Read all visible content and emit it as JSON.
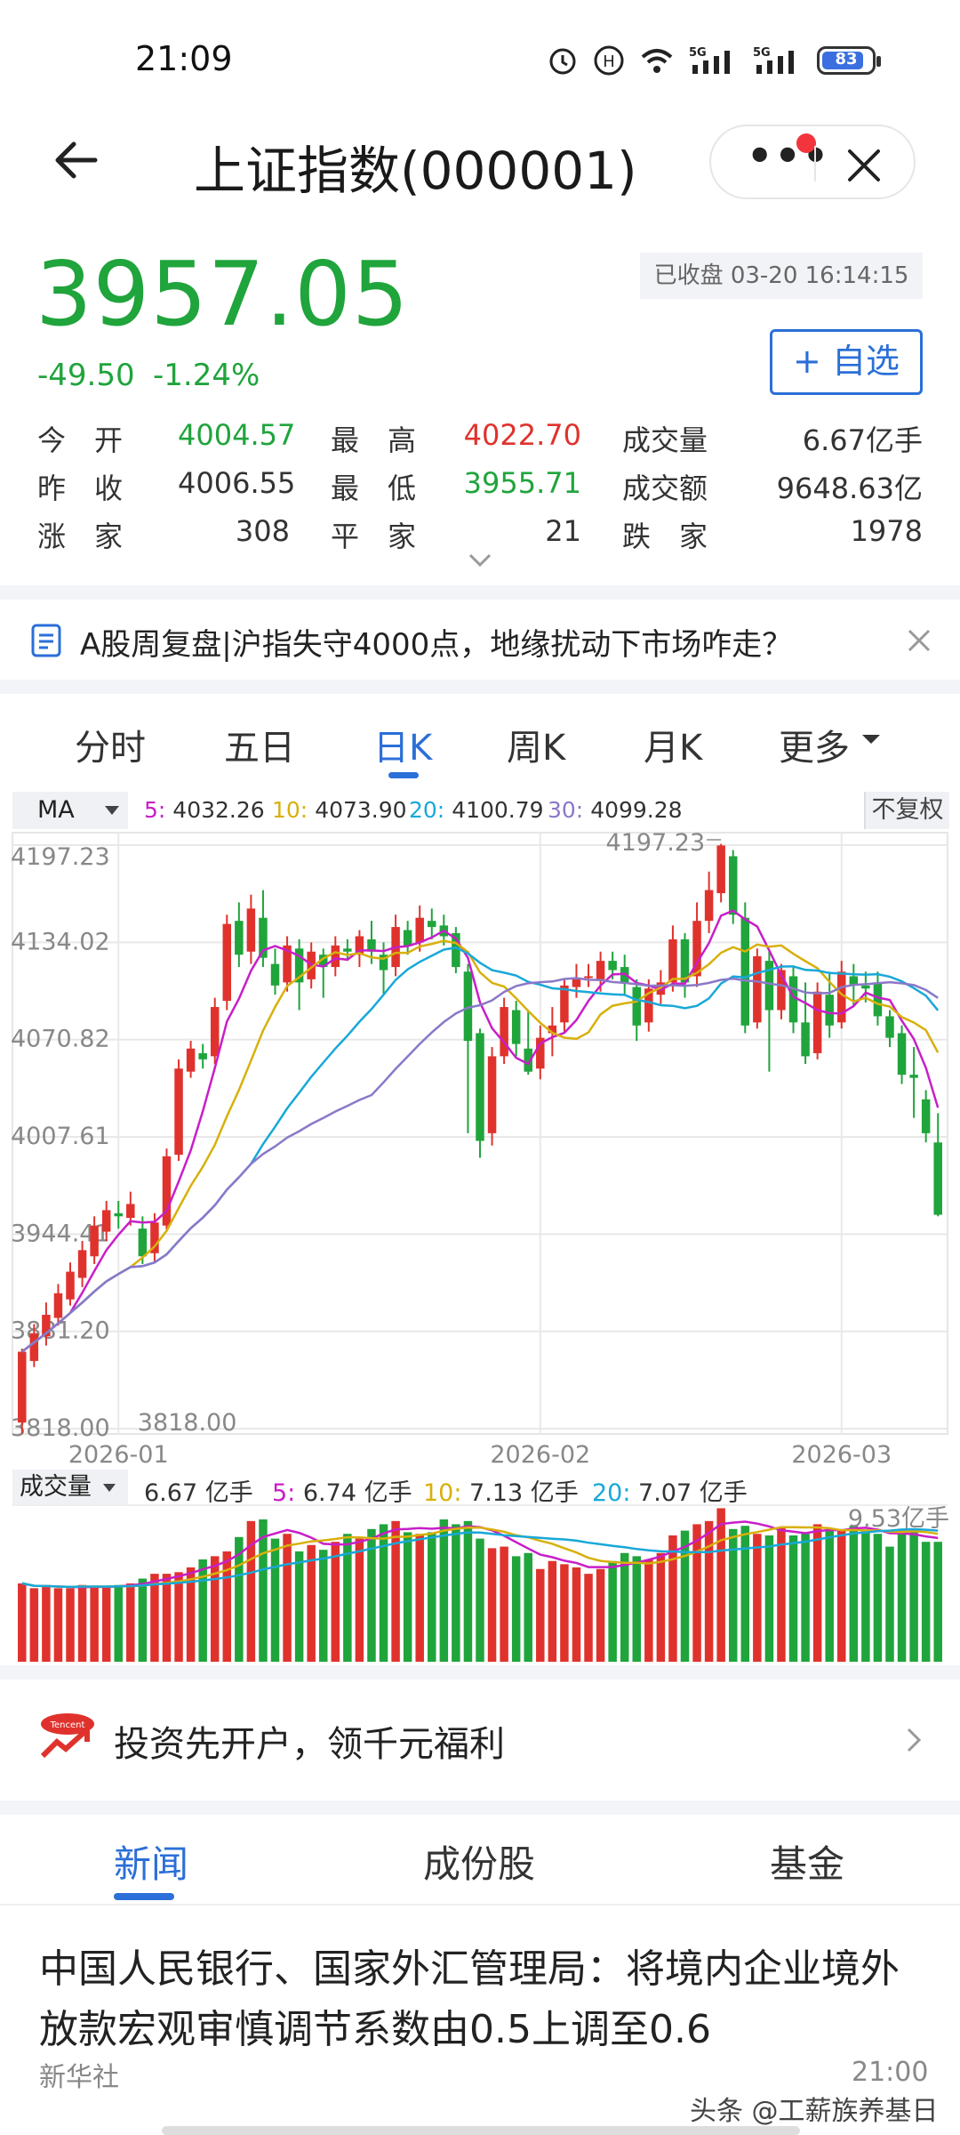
{
  "status_bar": {
    "time": "21:09",
    "battery": "83",
    "signal_1": "5G",
    "signal_2": "5G"
  },
  "header": {
    "title": "上证指数(000001)",
    "more_label": "•••"
  },
  "quote": {
    "price": "3957.05",
    "change": "-49.50",
    "change_pct": "-1.24%",
    "status": "已收盘 03-20 16:14:15",
    "watch_label": "+ 自选",
    "stats": [
      {
        "label": "今　开",
        "value": "4004.57"
      },
      {
        "label": "最　高",
        "value": "4022.70"
      },
      {
        "label": "成交量",
        "value": "6.67亿手"
      },
      {
        "label": "昨　收",
        "value": "4006.55"
      },
      {
        "label": "最　低",
        "value": "3955.71"
      },
      {
        "label": "成交额",
        "value": "9648.63亿"
      },
      {
        "label": "涨　家",
        "value": "308"
      },
      {
        "label": "平　家",
        "value": "21"
      },
      {
        "label": "跌　家",
        "value": "1978"
      }
    ]
  },
  "news_banner": {
    "text": "A股周复盘|沪指失守4000点，地缘扰动下市场咋走？"
  },
  "period_tabs": [
    "分时",
    "五日",
    "日K",
    "周K",
    "月K",
    "更多"
  ],
  "ma_bar": {
    "select": "MA",
    "items": [
      {
        "key": "5:",
        "value": "4032.26",
        "color": "#c81ec8"
      },
      {
        "key": "10:",
        "value": "4073.90",
        "color": "#d8b00c"
      },
      {
        "key": "20:",
        "value": "4100.79",
        "color": "#18a8d8"
      },
      {
        "key": "30:",
        "value": "4099.28",
        "color": "#8a78c8"
      }
    ],
    "adjust": "不复权"
  },
  "volume_bar": {
    "select": "成交量",
    "current": "6.67 亿手",
    "items": [
      {
        "key": "5:",
        "value": "6.74 亿手",
        "color": "#c81ec8"
      },
      {
        "key": "10:",
        "value": "7.13 亿手",
        "color": "#d8b00c"
      },
      {
        "key": "20:",
        "value": "7.07 亿手",
        "color": "#18a8d8"
      }
    ],
    "max_label": "9.53亿手"
  },
  "chart_data": {
    "type": "candlestick",
    "ylim": [
      3818.0,
      4197.23
    ],
    "y_ticks": [
      "4197.23",
      "4134.02",
      "4070.82",
      "4007.61",
      "3944.41",
      "3881.20",
      "3818.00"
    ],
    "x_ticks": [
      "2026-01",
      "2026-02",
      "2026-03"
    ],
    "high_label": "4197.23",
    "low_label": "3818.00",
    "candles": [
      [
        3822,
        3868,
        3815,
        3870
      ],
      [
        3862,
        3880,
        3858,
        3886
      ],
      [
        3878,
        3892,
        3872,
        3900
      ],
      [
        3890,
        3906,
        3885,
        3912
      ],
      [
        3902,
        3920,
        3898,
        3926
      ],
      [
        3916,
        3934,
        3910,
        3940
      ],
      [
        3930,
        3950,
        3925,
        3956
      ],
      [
        3946,
        3960,
        3940,
        3966
      ],
      [
        3958,
        3956,
        3948,
        3966
      ],
      [
        3955,
        3964,
        3950,
        3972
      ],
      [
        3948,
        3930,
        3925,
        3956
      ],
      [
        3932,
        3952,
        3926,
        3958
      ],
      [
        3950,
        3995,
        3946,
        4000
      ],
      [
        3996,
        4052,
        3992,
        4058
      ],
      [
        4050,
        4065,
        4046,
        4070
      ],
      [
        4062,
        4058,
        4052,
        4068
      ],
      [
        4060,
        4092,
        4055,
        4098
      ],
      [
        4096,
        4146,
        4090,
        4152
      ],
      [
        4148,
        4126,
        4118,
        4160
      ],
      [
        4128,
        4156,
        4120,
        4165
      ],
      [
        4150,
        4124,
        4118,
        4168
      ],
      [
        4120,
        4106,
        4100,
        4130
      ],
      [
        4108,
        4132,
        4102,
        4138
      ],
      [
        4130,
        4108,
        4090,
        4136
      ],
      [
        4110,
        4128,
        4104,
        4134
      ],
      [
        4126,
        4118,
        4098,
        4130
      ],
      [
        4118,
        4132,
        4112,
        4138
      ],
      [
        4130,
        4128,
        4122,
        4136
      ],
      [
        4126,
        4138,
        4118,
        4142
      ],
      [
        4136,
        4128,
        4120,
        4148
      ],
      [
        4126,
        4116,
        4100,
        4134
      ],
      [
        4118,
        4144,
        4112,
        4152
      ],
      [
        4142,
        4132,
        4126,
        4148
      ],
      [
        4134,
        4150,
        4128,
        4158
      ],
      [
        4148,
        4144,
        4136,
        4156
      ],
      [
        4145,
        4138,
        4132,
        4152
      ],
      [
        4140,
        4118,
        4114,
        4144
      ],
      [
        4115,
        4070,
        4010,
        4120
      ],
      [
        4075,
        4005,
        3994,
        4078
      ],
      [
        4010,
        4060,
        4002,
        4066
      ],
      [
        4060,
        4092,
        4055,
        4098
      ],
      [
        4090,
        4068,
        4060,
        4096
      ],
      [
        4065,
        4050,
        4048,
        4090
      ],
      [
        4052,
        4072,
        4045,
        4080
      ],
      [
        4075,
        4080,
        4060,
        4092
      ],
      [
        4082,
        4106,
        4075,
        4110
      ],
      [
        4105,
        4110,
        4098,
        4120
      ],
      [
        4112,
        4112,
        4105,
        4120
      ],
      [
        4110,
        4122,
        4102,
        4128
      ],
      [
        4122,
        4116,
        4110,
        4128
      ],
      [
        4118,
        4108,
        4100,
        4126
      ],
      [
        4105,
        4080,
        4070,
        4110
      ],
      [
        4082,
        4104,
        4076,
        4110
      ],
      [
        4100,
        4108,
        4094,
        4116
      ],
      [
        4108,
        4136,
        4102,
        4145
      ],
      [
        4136,
        4108,
        4098,
        4140
      ],
      [
        4112,
        4148,
        4105,
        4160
      ],
      [
        4148,
        4168,
        4140,
        4180
      ],
      [
        4166,
        4197,
        4160,
        4198
      ],
      [
        4190,
        4152,
        4146,
        4194
      ],
      [
        4150,
        4080,
        4075,
        4160
      ],
      [
        4082,
        4125,
        4078,
        4130
      ],
      [
        4122,
        4090,
        4050,
        4128
      ],
      [
        4090,
        4116,
        4084,
        4120
      ],
      [
        4112,
        4082,
        4075,
        4118
      ],
      [
        4082,
        4060,
        4055,
        4108
      ],
      [
        4062,
        4102,
        4058,
        4108
      ],
      [
        4100,
        4080,
        4072,
        4115
      ],
      [
        4082,
        4115,
        4078,
        4122
      ],
      [
        4112,
        4106,
        4092,
        4120
      ],
      [
        4106,
        4104,
        4095,
        4115
      ],
      [
        4108,
        4086,
        4080,
        4115
      ],
      [
        4086,
        4072,
        4066,
        4090
      ],
      [
        4075,
        4048,
        4042,
        4080
      ],
      [
        4048,
        4046,
        4020,
        4066
      ],
      [
        4032,
        4010,
        4004,
        4038
      ],
      [
        4004,
        3957,
        3956,
        4023
      ]
    ],
    "volume": [
      4.9,
      4.6,
      4.7,
      4.6,
      4.6,
      4.8,
      4.7,
      4.7,
      4.8,
      4.9,
      5.2,
      5.5,
      5.5,
      5.6,
      5.9,
      6.4,
      6.6,
      6.9,
      7.8,
      8.8,
      8.9,
      7.7,
      8.0,
      6.9,
      7.3,
      7.0,
      7.5,
      8.0,
      7.7,
      8.3,
      8.6,
      8.8,
      8.1,
      8.0,
      8.1,
      8.9,
      8.6,
      8.8,
      7.7,
      7.1,
      7.2,
      6.6,
      6.8,
      5.8,
      6.3,
      6.1,
      5.9,
      5.5,
      5.8,
      6.3,
      6.8,
      6.6,
      6.4,
      6.8,
      7.9,
      8.2,
      8.6,
      8.8,
      9.6,
      8.3,
      8.5,
      8.0,
      7.9,
      8.4,
      7.9,
      8.0,
      8.6,
      8.3,
      8.3,
      8.5,
      8.2,
      8.0,
      7.2,
      8.2,
      8.3,
      7.5,
      7.5
    ]
  },
  "promo": {
    "text": "投资先开户，领千元福利"
  },
  "content_tabs": [
    "新闻",
    "成份股",
    "基金"
  ],
  "article": {
    "title": "中国人民银行、国家外汇管理局：将境内企业境外放款宏观审慎调节系数由0.5上调至0.6",
    "source": "新华社",
    "time": "21:00"
  },
  "watermark": "头条 @工薪族养基日记",
  "colors": {
    "up": "#e0322d",
    "down": "#20a43c",
    "accent": "#2b6fd8"
  }
}
